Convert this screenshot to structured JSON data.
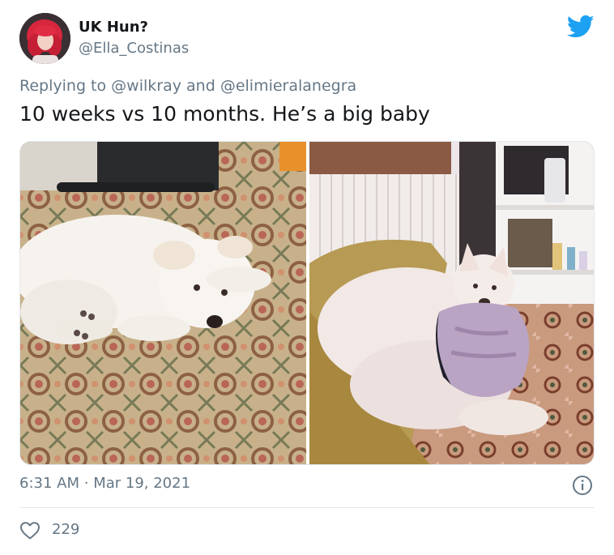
{
  "author": {
    "name": "UK Hun?",
    "handle": "@Ella_Costinas"
  },
  "reply": {
    "prefix": "Replying to",
    "mention_1": "@wilkray",
    "conjunction": "and",
    "mention_2": "@elimieralanegra"
  },
  "tweet_text": "10 weeks vs 10 months. He’s a big baby",
  "timestamp": {
    "time": "6:31 AM",
    "separator": "·",
    "date": "Mar 19, 2021"
  },
  "likes": "229",
  "icons": {
    "brand": "twitter-bird-icon",
    "info": "info-icon",
    "like": "heart-icon"
  },
  "colors": {
    "twitter_blue": "#1da1f2",
    "secondary_text": "#657786",
    "primary_text": "#14171a"
  }
}
